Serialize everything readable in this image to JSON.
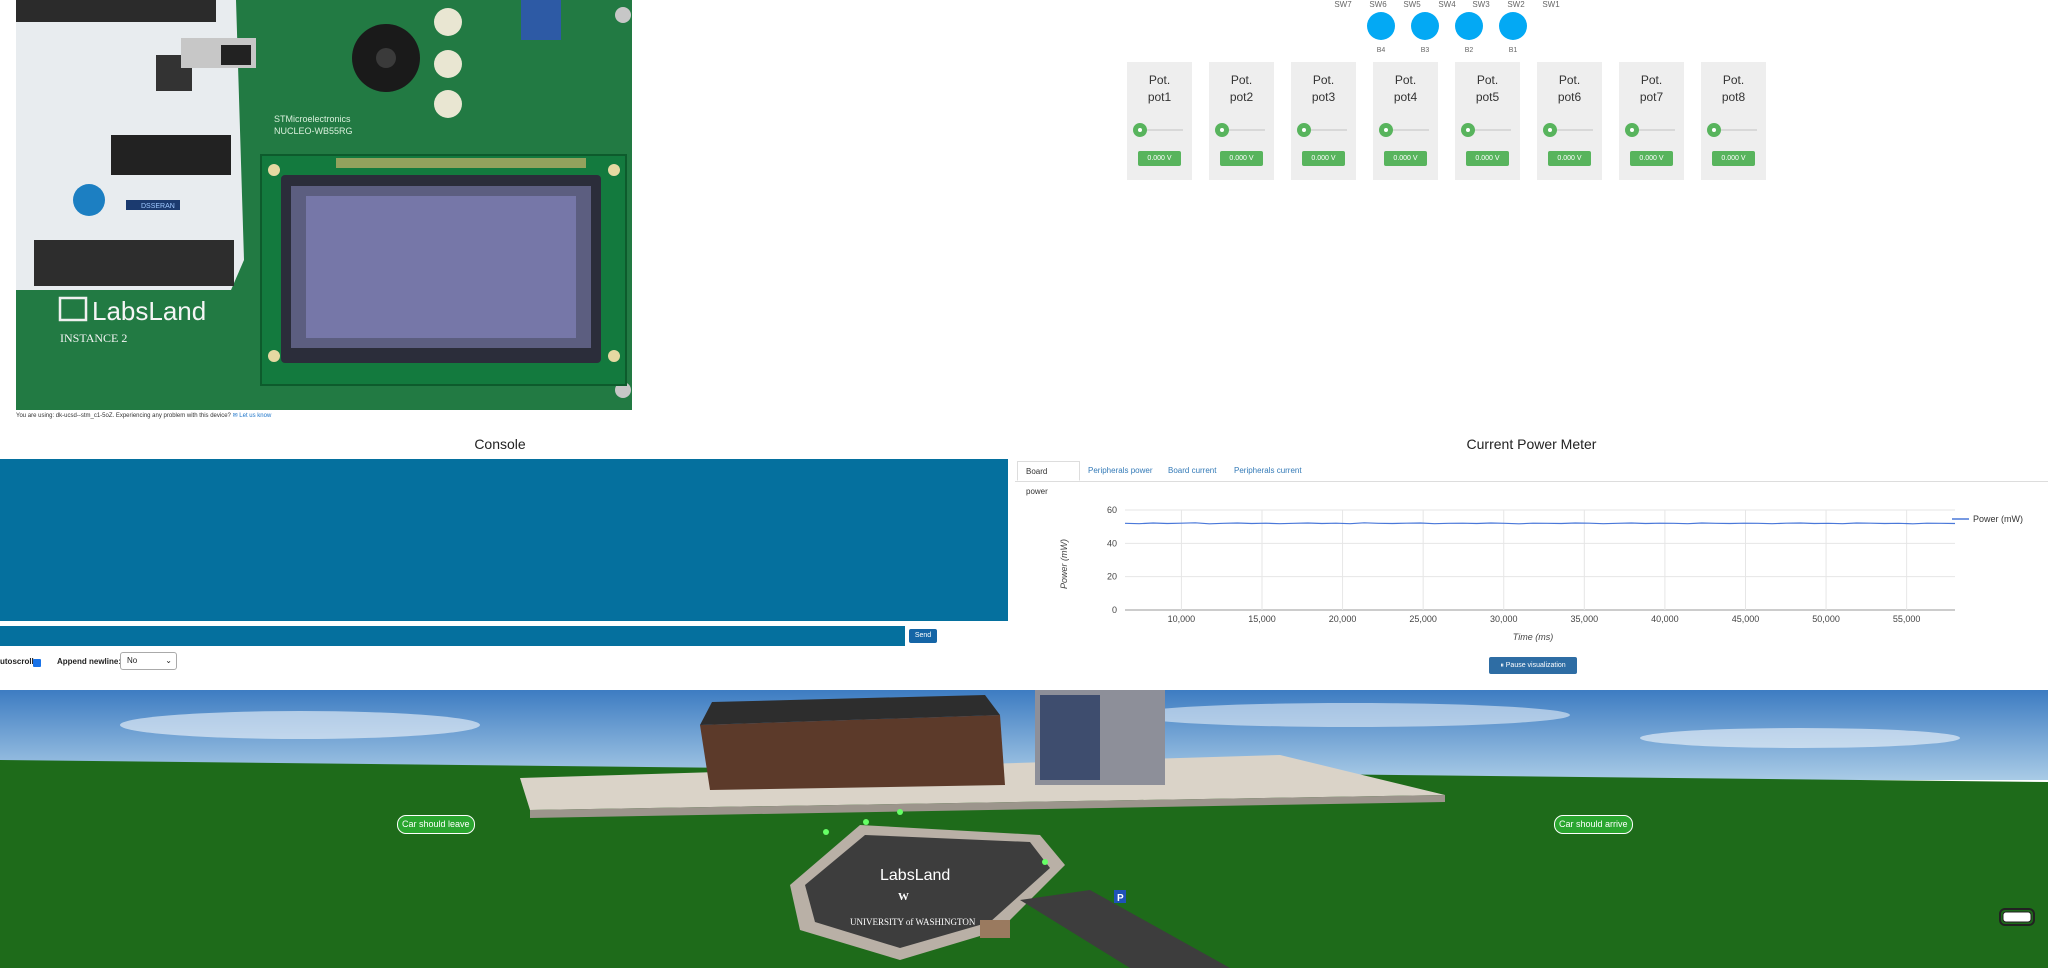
{
  "board": {
    "silkscreen_lines": [
      "STMicroelectronics",
      "NUCLEO-WB55RG"
    ],
    "brand": "LabsLand",
    "instance": "INSTANCE 2",
    "chip_label": "DSSERAN"
  },
  "device_info": {
    "text": "You are using: dk-ucsd--stm_c1-5oZ. Experiencing any problem with this device?",
    "link": "Let us know"
  },
  "switches": {
    "labels": [
      "SW7",
      "SW6",
      "SW5",
      "SW4",
      "SW3",
      "SW2",
      "SW1"
    ],
    "buttons": [
      "B4",
      "B3",
      "B2",
      "B1"
    ],
    "color": "#03a9f4"
  },
  "pots": [
    {
      "title": "Pot.",
      "name": "pot1",
      "value": "0.000 V"
    },
    {
      "title": "Pot.",
      "name": "pot2",
      "value": "0.000 V"
    },
    {
      "title": "Pot.",
      "name": "pot3",
      "value": "0.000 V"
    },
    {
      "title": "Pot.",
      "name": "pot4",
      "value": "0.000 V"
    },
    {
      "title": "Pot.",
      "name": "pot5",
      "value": "0.000 V"
    },
    {
      "title": "Pot.",
      "name": "pot6",
      "value": "0.000 V"
    },
    {
      "title": "Pot.",
      "name": "pot7",
      "value": "0.000 V"
    },
    {
      "title": "Pot.",
      "name": "pot8",
      "value": "0.000 V"
    }
  ],
  "console": {
    "title": "Console",
    "input_value": "",
    "send_label": "Send",
    "autoscroll_label": "utoscroll:",
    "autoscroll_checked": true,
    "newline_label": "Append newline:",
    "newline_value": "No",
    "bg_color": "#05709e"
  },
  "power_meter": {
    "title": "Current Power Meter",
    "tabs": [
      "Board power",
      "Peripherals power",
      "Board current",
      "Peripherals current"
    ],
    "active_tab": "Board power",
    "pause_label": "⏸ Pause visualization"
  },
  "chart_data": {
    "type": "line",
    "series": [
      {
        "name": "Power (mW)",
        "color": "#4a78d9",
        "values": [
          52.0,
          51.8,
          52.2,
          51.9,
          52.1,
          52.3,
          51.7,
          52.0,
          52.2,
          51.9,
          52.1,
          51.8,
          52.0,
          52.2,
          51.9,
          52.1,
          51.8,
          52.3,
          52.0,
          51.9,
          52.1,
          52.2,
          51.8,
          52.0,
          52.1,
          51.9,
          52.2,
          52.0,
          51.7,
          52.1,
          52.0,
          51.9,
          52.2,
          52.1,
          51.8,
          52.0,
          52.2,
          51.9,
          52.1,
          52.0,
          51.8,
          52.2,
          52.0,
          51.9,
          52.1,
          52.0,
          51.8,
          52.1,
          52.2,
          51.9,
          52.0,
          51.8,
          52.2,
          52.1,
          51.9,
          52.0,
          51.7,
          52.1,
          52.0,
          51.9
        ]
      }
    ],
    "x_start": 6500,
    "x_end": 58000,
    "xlabel": "Time (ms)",
    "ylabel": "Power (mW)",
    "ylim": [
      0,
      60
    ],
    "yticks": [
      0,
      20,
      40,
      60
    ],
    "xticks": [
      10000,
      15000,
      20000,
      25000,
      30000,
      35000,
      40000,
      45000,
      50000,
      55000
    ],
    "xtick_labels": [
      "10,000",
      "15,000",
      "20,000",
      "25,000",
      "30,000",
      "35,000",
      "40,000",
      "45,000",
      "50,000",
      "55,000"
    ],
    "grid": true,
    "legend": "top-right"
  },
  "scene": {
    "badge_leave": "Car should leave",
    "badge_arrive": "Car should arrive",
    "parking_text": [
      "LabsLand",
      "W",
      "UNIVERSITY of WASHINGTON"
    ],
    "parking_sign": "P"
  }
}
